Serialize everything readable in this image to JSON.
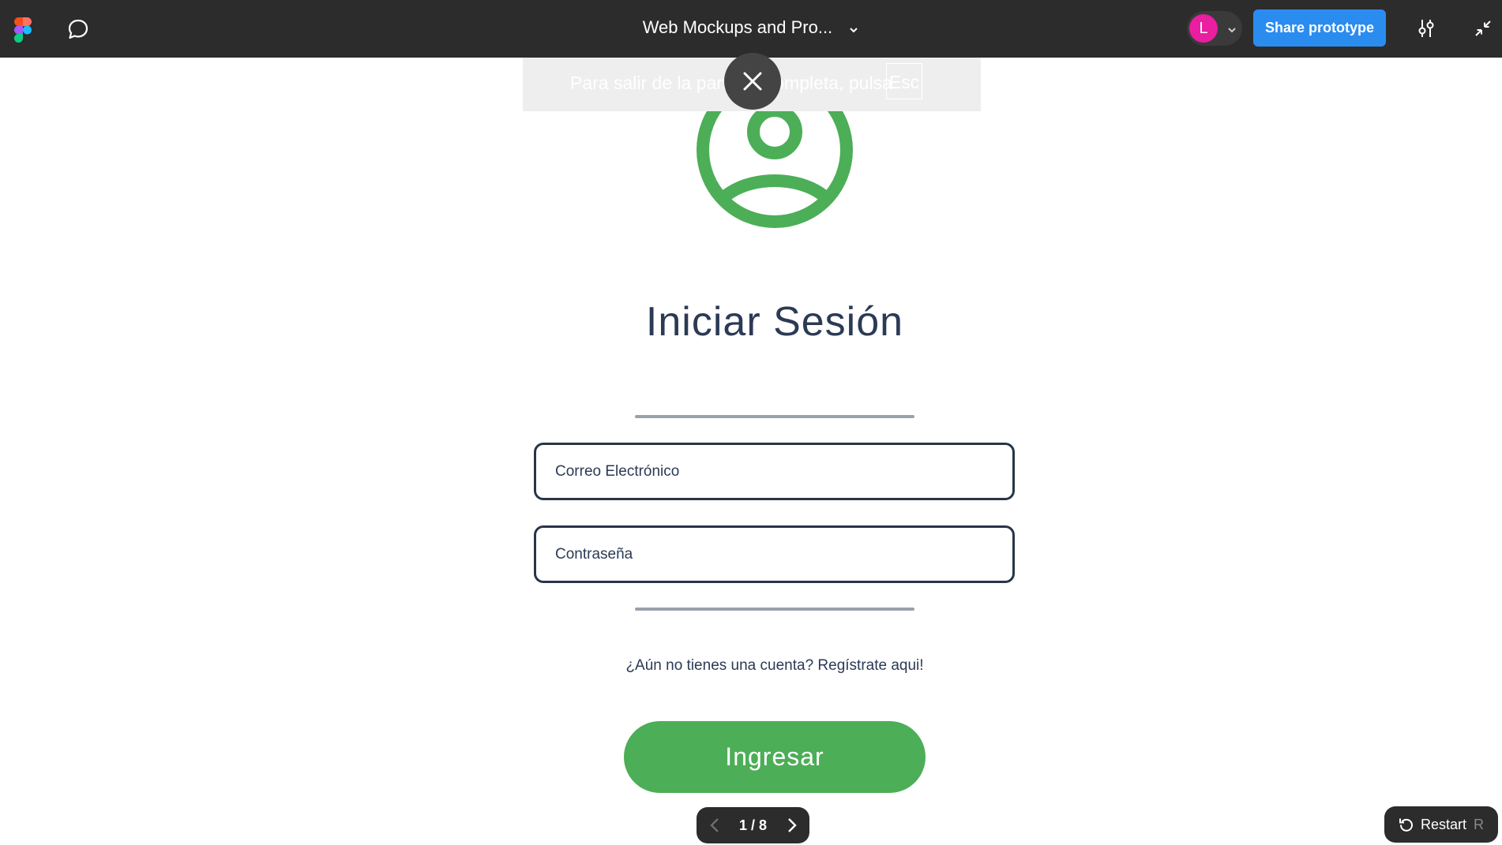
{
  "topbar": {
    "file_title": "Web Mockups and Pro...",
    "avatar_letter": "L",
    "share_label": "Share prototype",
    "avatar_color": "#e91ea0",
    "share_color": "#2b8cf0"
  },
  "fullscreen_notice": {
    "message": "Para salir de la pantalla completa, pulsa",
    "key": "Esc"
  },
  "login": {
    "title": "Iniciar Sesión",
    "email_placeholder": "Correo Electrónico",
    "password_placeholder": "Contraseña",
    "register_text": "¿Aún no tienes una cuenta? Regístrate aqui!",
    "submit_label": "Ingresar",
    "accent_color": "#4cae57",
    "text_color": "#2b3a55"
  },
  "pager": {
    "label": "1 / 8"
  },
  "restart": {
    "label": "Restart",
    "shortcut": "R"
  }
}
